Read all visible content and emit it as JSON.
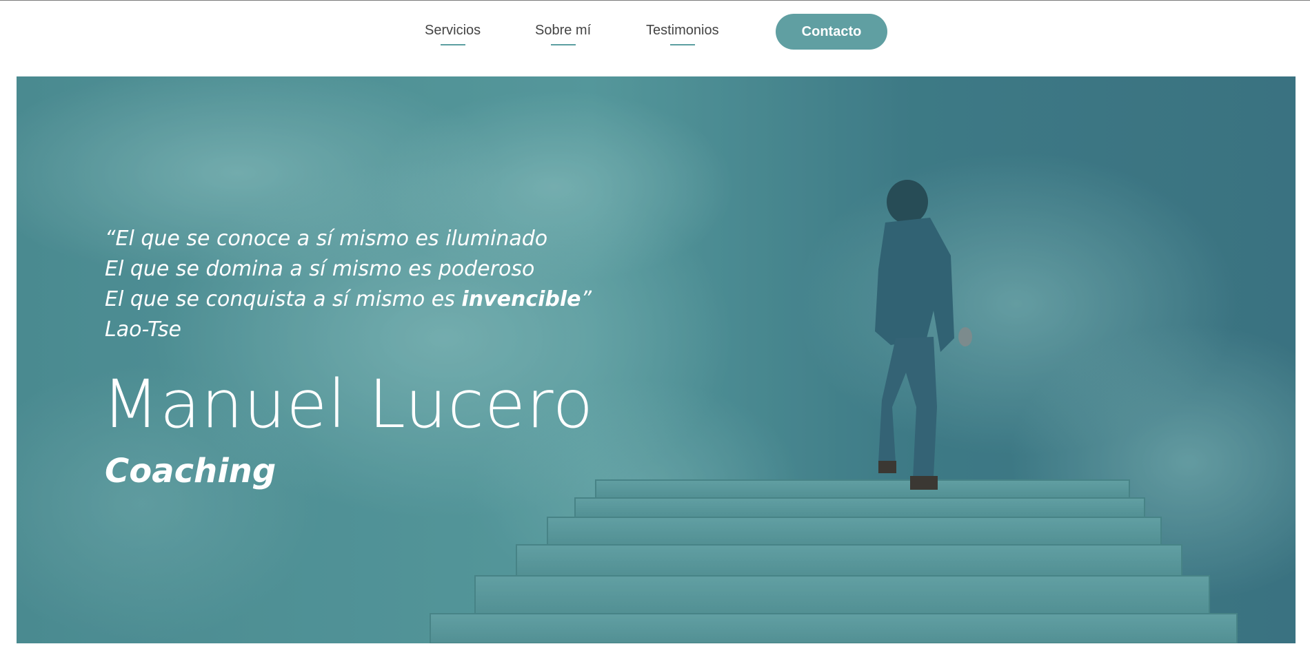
{
  "nav": {
    "items": [
      {
        "label": "Servicios"
      },
      {
        "label": "Sobre mí"
      },
      {
        "label": "Testimonios"
      }
    ],
    "contact_label": "Contacto"
  },
  "hero": {
    "quote_lines": [
      "“El que se conoce a sí mismo es iluminado",
      "El que se domina a sí mismo es poderoso",
      "El que se conquista a sí mismo es "
    ],
    "quote_emphasis": "invencible",
    "quote_close": "”",
    "quote_author": "Lao-Tse",
    "name": "Manuel Lucero",
    "subtitle": "Coaching",
    "image": "man-climbing-stairs-to-sky"
  },
  "colors": {
    "accent": "#609fa2",
    "overlay": "#3f7c86",
    "nav_text": "#444444"
  }
}
